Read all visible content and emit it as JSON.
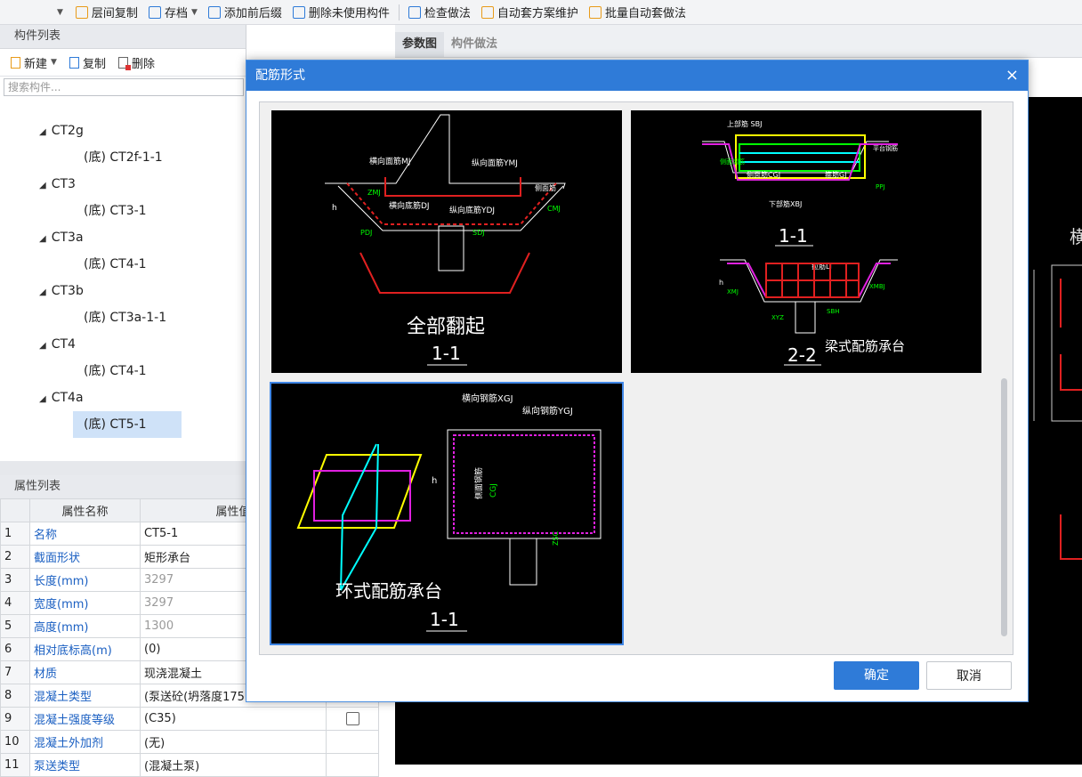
{
  "toolbar": {
    "items": [
      "层间复制",
      "存档",
      "添加前后缀",
      "删除未使用构件",
      "检查做法",
      "自动套方案维护",
      "批量自动套做法"
    ]
  },
  "component_list": {
    "title": "构件列表",
    "new_label": "新建",
    "copy_label": "复制",
    "delete_label": "删除",
    "search_placeholder": "搜索构件...",
    "tree": [
      {
        "label": "CT2g",
        "child": "(底) CT2f-1-1"
      },
      {
        "label": "CT3",
        "child": "(底) CT3-1"
      },
      {
        "label": "CT3a",
        "child": "(底) CT4-1"
      },
      {
        "label": "CT3b",
        "child": "(底) CT3a-1-1"
      },
      {
        "label": "CT4",
        "child": "(底) CT4-1"
      },
      {
        "label": "CT4a",
        "child": "(底) CT5-1"
      }
    ]
  },
  "property_list": {
    "title": "属性列表",
    "col_name": "属性名称",
    "col_value": "属性值",
    "rows": [
      {
        "no": "1",
        "name": "名称",
        "value": "CT5-1"
      },
      {
        "no": "2",
        "name": "截面形状",
        "value": "矩形承台"
      },
      {
        "no": "3",
        "name": "长度(mm)",
        "value": "3297"
      },
      {
        "no": "4",
        "name": "宽度(mm)",
        "value": "3297"
      },
      {
        "no": "5",
        "name": "高度(mm)",
        "value": "1300"
      },
      {
        "no": "6",
        "name": "相对底标高(m)",
        "value": "(0)"
      },
      {
        "no": "7",
        "name": "材质",
        "value": "现浇混凝土"
      },
      {
        "no": "8",
        "name": "混凝土类型",
        "value": "(泵送砼(坍落度175"
      },
      {
        "no": "9",
        "name": "混凝土强度等级",
        "value": "(C35)"
      },
      {
        "no": "10",
        "name": "混凝土外加剂",
        "value": "(无)"
      },
      {
        "no": "11",
        "name": "泵送类型",
        "value": "(混凝土泵)"
      }
    ]
  },
  "right_tabs": {
    "tab1": "参数图",
    "tab2": "构件做法"
  },
  "bg_label": "横",
  "dialog": {
    "title": "配筋形式",
    "close": "×",
    "ok": "确定",
    "cancel": "取消",
    "options": [
      {
        "caption": "全部翻起",
        "section": "1-1",
        "labels": {
          "a": "横向面筋MJ",
          "b": "纵向面筋YMJ",
          "c": "横向底筋DJ",
          "d": "纵向底筋YDJ",
          "e": "CMJ",
          "f": "ZMJ",
          "g": "侧面筋",
          "h": "PDJ",
          "i": "h",
          "j": "SDJ"
        }
      },
      {
        "caption": "梁式配筋承台",
        "section1": "1-1",
        "section2": "2-2",
        "labels": {
          "a": "上部筋 SBJ",
          "b": "侧面筋CGJ",
          "c": "箍筋GJ",
          "d": "下部筋XBJ",
          "e": "拉筋LJ",
          "f": "XMJ",
          "g": "XMBJ",
          "h": "PPJ",
          "i": "XYZ",
          "j": "h",
          "k": "SBH",
          "l": "侧面钢筋",
          "m": "平台钢筋"
        }
      },
      {
        "caption": "环式配筋承台",
        "section": "1-1",
        "labels": {
          "a": "横向钢筋XGJ",
          "b": "纵向钢筋YGJ",
          "c": "侧面钢筋",
          "d": "CGJ",
          "e": "h",
          "f": "ZSC"
        }
      }
    ]
  }
}
